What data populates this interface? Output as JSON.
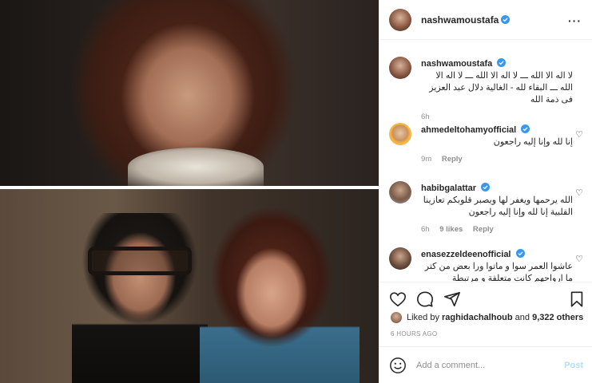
{
  "post": {
    "username": "nashwamoustafa",
    "caption": "لا اله الا الله ـــ لا اله الا الله ـــ لا اله الا الله ـــ البقاء لله - الغالية دلال عبد العزيز فى ذمة الله",
    "caption_time": "6h"
  },
  "comments": [
    {
      "username": "ahmedeltohamyofficial",
      "text": "إنا لله وإنا إليه راجعون",
      "time": "9m",
      "likes": "",
      "reply": "Reply"
    },
    {
      "username": "habibgalattar",
      "text": "الله يرحمها ويغفر لها ويصبر قلوبكم تعازينا القلبية إنا لله وإنا إليه راجعون",
      "time": "6h",
      "likes": "9 likes",
      "reply": "Reply"
    },
    {
      "username": "enasezzeldeenofficial",
      "text": "عاشوا العمر سوا و ماتوا ورا بعض من كتر ما ارواحهم كانت متعلقة و مرتبطة",
      "time": "",
      "likes": "",
      "reply": ""
    }
  ],
  "likes": {
    "prefix": "Liked by ",
    "user": "raghidachalhoub",
    "middle": " and ",
    "count": "9,322 others"
  },
  "timestamp": "6 HOURS AGO",
  "add_comment": {
    "placeholder": "Add a comment...",
    "post_label": "Post"
  },
  "icons": {
    "more": "more-horizontal-icon",
    "heart": "heart-icon",
    "comment": "comment-icon",
    "share": "share-icon",
    "save": "bookmark-icon",
    "emoji": "emoji-icon",
    "verified": "verified-badge-icon"
  },
  "colors": {
    "verified": "#3897f0",
    "post_disabled": "#b2dffc",
    "muted": "#8e8e8e"
  }
}
